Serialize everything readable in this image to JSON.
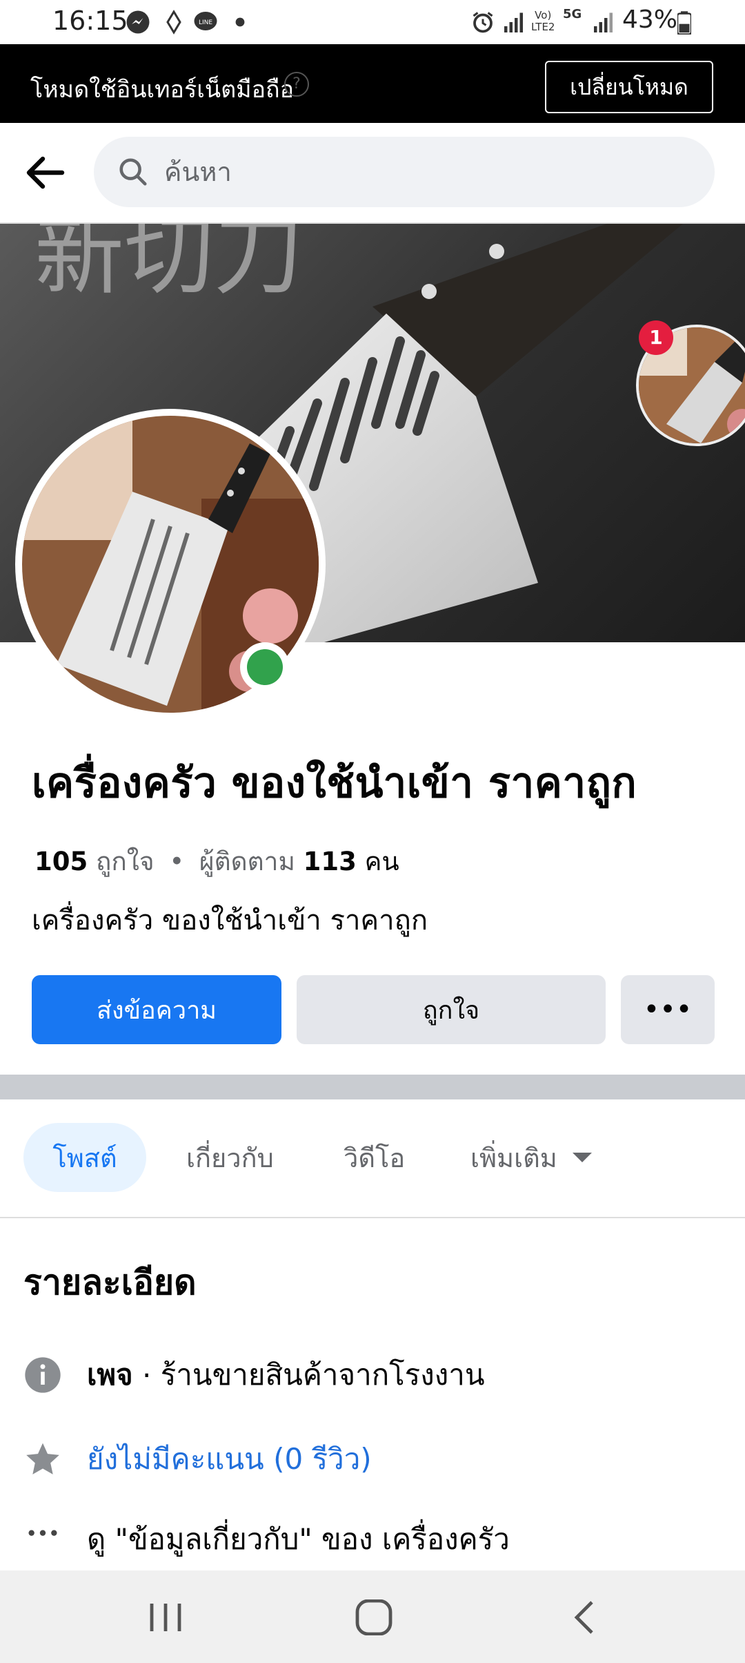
{
  "status_bar": {
    "time": "16:15",
    "battery": "43%",
    "icons": [
      "messenger-icon",
      "signal-icon",
      "line-icon",
      "dot-icon",
      "alarm-icon",
      "wifi-signal-icon",
      "volte-icon",
      "5g-icon",
      "cell-signal-icon",
      "battery-icon"
    ],
    "network_labels": [
      "Vo)",
      "LTE2",
      "5G"
    ]
  },
  "banner": {
    "text": "โหมดใช้อินเทอร์เน็ตมือถือ",
    "button": "เปลี่ยนโหมด"
  },
  "search": {
    "placeholder": "ค้นหา"
  },
  "cover": {
    "badge_count": "1",
    "overlay_text": "新切刀"
  },
  "page": {
    "name": "เครื่องครัว ของใช้นำเข้า ราคาถูก",
    "likes_count": "105",
    "likes_label": "ถูกใจ",
    "separator": "•",
    "followers_label": "ผู้ติดตาม",
    "followers_count": "113",
    "followers_unit": "คน",
    "subtitle": "เครื่องครัว ของใช้นำเข้า ราคาถูก"
  },
  "actions": {
    "message": "ส่งข้อความ",
    "like": "ถูกใจ",
    "more": "•••"
  },
  "tabs": {
    "posts": "โพสต์",
    "about": "เกี่ยวกับ",
    "videos": "วิดีโอ",
    "more": "เพิ่มเติม"
  },
  "details": {
    "title": "รายละเอียด",
    "category_label": "เพจ",
    "category_sep": " · ",
    "category": "ร้านขายสินค้าจากโรงงาน",
    "rating": "ยังไม่มีคะแนน (0 รีวิว)",
    "about_link": "ดู \"ข้อมูลเกี่ยวกับ\" ของ เครื่องครัว"
  },
  "colors": {
    "primary": "#1877f2",
    "link": "#216fdb",
    "online": "#31a24c",
    "badge": "#e41e3f"
  }
}
